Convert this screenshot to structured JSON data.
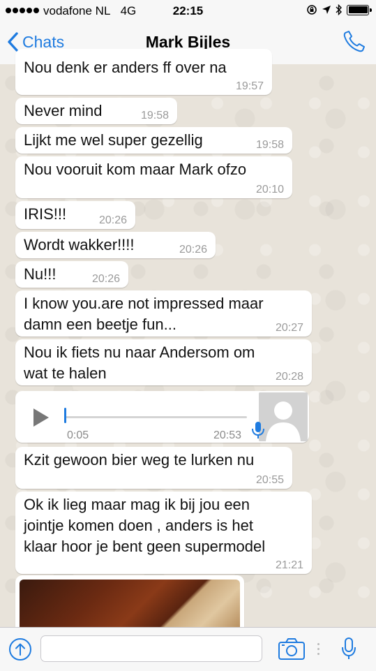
{
  "status_bar": {
    "carrier": "vodafone NL",
    "network": "4G",
    "time": "22:15"
  },
  "header": {
    "back_label": "Chats",
    "contact_name": "Mark Bijles"
  },
  "messages": [
    {
      "text": "Nou denk er anders ff over na",
      "time": "19:57"
    },
    {
      "text": "Never mind",
      "time": "19:58"
    },
    {
      "text": "Lijkt me wel super gezellig",
      "time": "19:58"
    },
    {
      "text": "Nou vooruit kom maar Mark ofzo",
      "time": "20:10"
    },
    {
      "text": "IRIS!!!",
      "time": "20:26"
    },
    {
      "text": "Wordt wakker!!!!",
      "time": "20:26"
    },
    {
      "text": "Nu!!!",
      "time": "20:26"
    },
    {
      "text": "I know you.are not impressed maar\ndamn een beetje fun...",
      "time": "20:27"
    },
    {
      "text": "Nou ik fiets nu naar Andersom om\nwat te halen",
      "time": "20:28"
    },
    {
      "text": "Kzit gewoon bier weg te lurken nu",
      "time": "20:55"
    },
    {
      "text": "Ok ik lieg maar mag ik bij jou een\njointje komen doen , anders is het\nklaar hoor je bent geen supermodel",
      "time": "21:21"
    }
  ],
  "voice_message": {
    "duration": "0:05",
    "time": "20:53",
    "progress": 0
  },
  "input": {
    "value": "",
    "placeholder": ""
  },
  "icons": {
    "back": "chevron-left-icon",
    "call": "phone-icon",
    "upload": "upload-arrow-icon",
    "camera": "camera-icon",
    "mic": "microphone-icon",
    "play": "play-icon"
  },
  "colors": {
    "accent": "#1e7be0",
    "bubble": "#ffffff",
    "timestamp": "#9a9a9a"
  }
}
